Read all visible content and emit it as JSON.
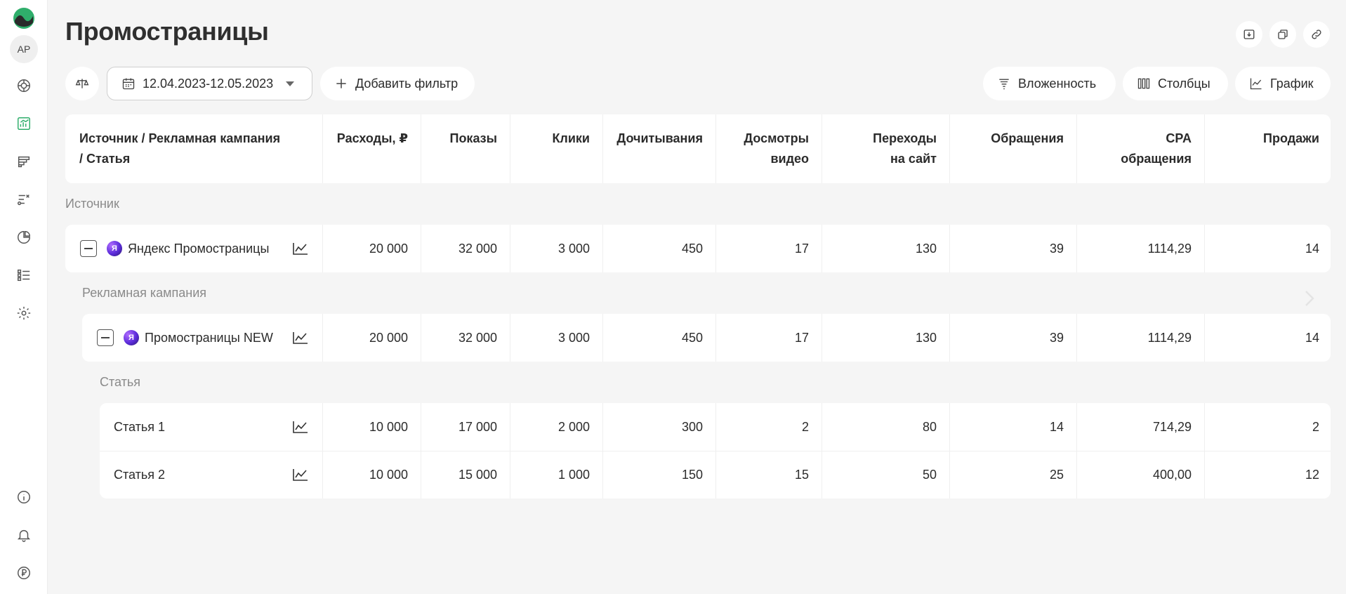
{
  "sidebar": {
    "avatar": "AP",
    "icons": [
      "logo-icon",
      "dashboard-icon",
      "reports-icon",
      "funnel-icon",
      "attribution-icon",
      "pie-chart-icon",
      "list-icon",
      "settings-icon",
      "info-icon",
      "bell-icon",
      "ruble-icon"
    ]
  },
  "header": {
    "title": "Промостраницы",
    "actions": [
      "download-icon",
      "copy-icon",
      "link-icon"
    ]
  },
  "toolbar": {
    "date_range": "12.04.2023-12.05.2023",
    "add_filter": "Добавить фильтр",
    "nesting": "Вложенность",
    "columns": "Столбцы",
    "chart": "График"
  },
  "table": {
    "headers": {
      "name_line1": "Источник / Рекламная кампания",
      "name_line2": "/ Статья",
      "cols": [
        [
          "Расходы, ₽"
        ],
        [
          "Показы"
        ],
        [
          "Клики"
        ],
        [
          "Дочитывания"
        ],
        [
          "Досмотры",
          "видео"
        ],
        [
          "Переходы",
          "на сайт"
        ],
        [
          "Обращения"
        ],
        [
          "CPA",
          "обращения"
        ],
        [
          "Продажи"
        ]
      ]
    },
    "group_source": "Источник",
    "group_campaign": "Рекламная кампания",
    "group_article": "Статья",
    "rows": [
      {
        "name": "Яндекс Промостраницы",
        "values": [
          "20 000",
          "32 000",
          "3 000",
          "450",
          "17",
          "130",
          "39",
          "1114,29",
          "14"
        ]
      },
      {
        "name": "Промостраницы NEW",
        "values": [
          "20 000",
          "32 000",
          "3 000",
          "450",
          "17",
          "130",
          "39",
          "1114,29",
          "14"
        ]
      },
      {
        "name": "Статья 1",
        "values": [
          "10 000",
          "17 000",
          "2 000",
          "300",
          "2",
          "80",
          "14",
          "714,29",
          "2"
        ]
      },
      {
        "name": "Статья 2",
        "values": [
          "10 000",
          "15 000",
          "1 000",
          "150",
          "15",
          "50",
          "25",
          "400,00",
          "12"
        ]
      }
    ]
  },
  "colors": {
    "accent": "#2fae6b",
    "background": "#f5f5f5"
  }
}
